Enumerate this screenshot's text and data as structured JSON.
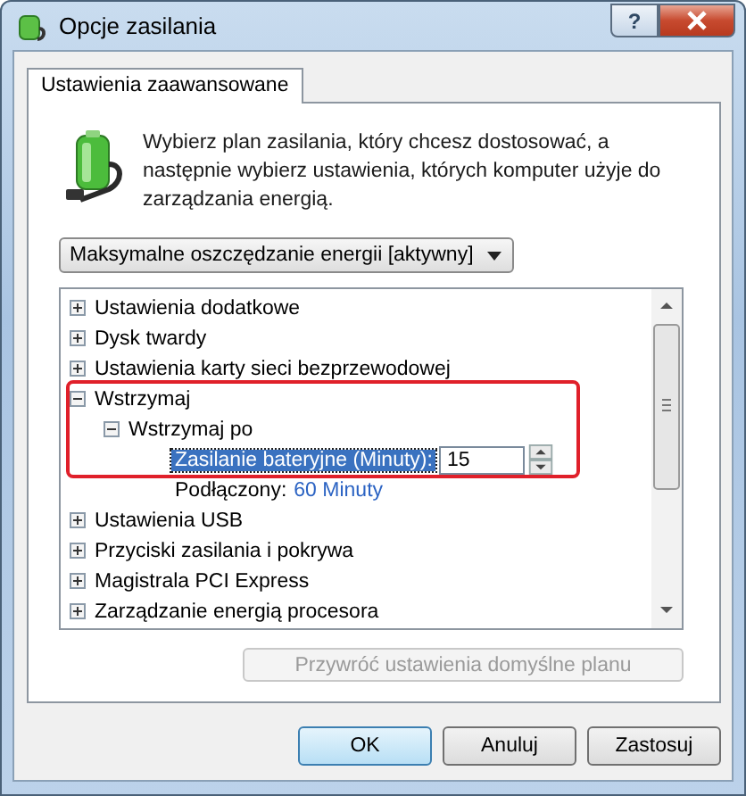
{
  "window": {
    "title": "Opcje zasilania",
    "help_button": "?"
  },
  "tabs": [
    {
      "label": "Ustawienia zaawansowane",
      "selected": true
    }
  ],
  "description": "Wybierz plan zasilania, który chcesz dostosować, a następnie wybierz ustawienia, których komputer użyje do zarządzania energią.",
  "plan_dropdown": {
    "value": "Maksymalne oszczędzanie energii [aktywny]"
  },
  "tree": [
    {
      "kind": "group",
      "label": "Ustawienia dodatkowe",
      "expanded": false
    },
    {
      "kind": "group",
      "label": "Dysk twardy",
      "expanded": false
    },
    {
      "kind": "group",
      "label": "Ustawienia karty sieci bezprzewodowej",
      "expanded": false
    },
    {
      "kind": "group",
      "label": "Wstrzymaj",
      "expanded": true,
      "highlighted": true,
      "children": [
        {
          "kind": "group",
          "label": "Wstrzymaj po",
          "expanded": true,
          "children": [
            {
              "kind": "setting",
              "label": "Zasilanie bateryjne (Minuty):",
              "value": "15",
              "selected": true
            },
            {
              "kind": "setting",
              "label": "Podłączony:",
              "value": "60 Minuty",
              "selected": false
            }
          ]
        }
      ]
    },
    {
      "kind": "group",
      "label": "Ustawienia USB",
      "expanded": false
    },
    {
      "kind": "group",
      "label": "Przyciski zasilania i pokrywa",
      "expanded": false
    },
    {
      "kind": "group",
      "label": "Magistrala PCI Express",
      "expanded": false
    },
    {
      "kind": "group",
      "label": "Zarządzanie energią procesora",
      "expanded": false
    }
  ],
  "restore_button": {
    "label": "Przywróć ustawienia domyślne planu",
    "disabled": true
  },
  "buttons": [
    {
      "label": "OK",
      "default": true
    },
    {
      "label": "Anuluj",
      "default": false
    },
    {
      "label": "Zastosuj",
      "default": false
    }
  ]
}
